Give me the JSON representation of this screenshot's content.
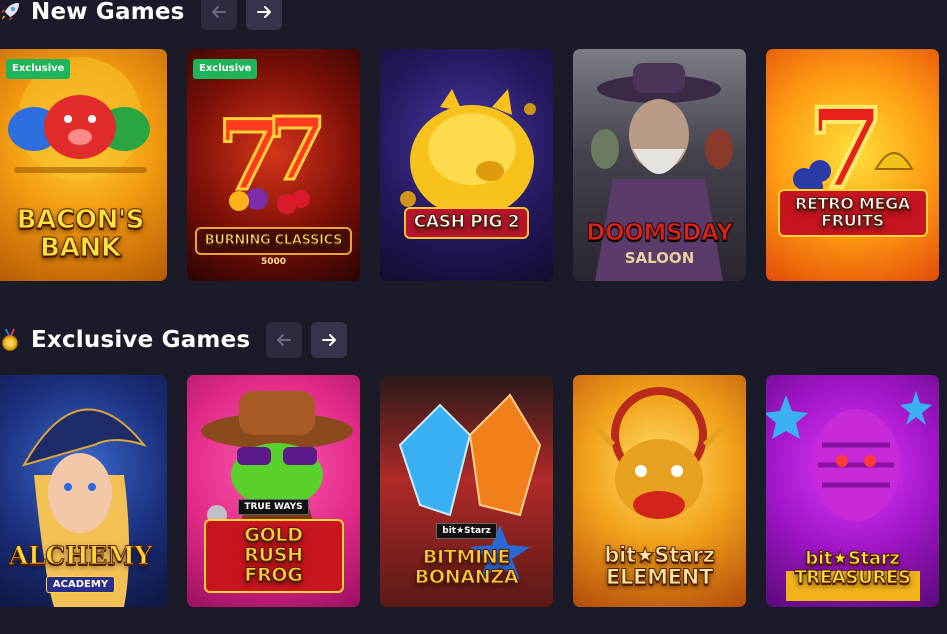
{
  "sections": [
    {
      "title": "New Games",
      "icon": "rocket-icon",
      "games": [
        {
          "title": "BACON'S BANK",
          "subtitle": "",
          "top_tag": "",
          "badge": "Exclusive"
        },
        {
          "title": "BURNING CLASSICS",
          "subtitle": "5000",
          "top_tag": "",
          "badge": "Exclusive"
        },
        {
          "title": "CASH PIG 2",
          "subtitle": "",
          "top_tag": "",
          "badge": ""
        },
        {
          "title": "DOOMSDAY",
          "subtitle": "SALOON",
          "top_tag": "",
          "badge": ""
        },
        {
          "title": "RETRO MEGA FRUITS",
          "subtitle": "",
          "top_tag": "",
          "badge": ""
        }
      ]
    },
    {
      "title": "Exclusive Games",
      "icon": "medal-icon",
      "games": [
        {
          "title": "ALCHEMY",
          "subtitle": "ACADEMY",
          "top_tag": "",
          "badge": ""
        },
        {
          "title": "GOLD RUSH FROG",
          "subtitle": "",
          "top_tag": "TRUE WAYS",
          "badge": ""
        },
        {
          "title": "BITMINE BONANZA",
          "subtitle": "",
          "top_tag": "bit★Starz",
          "badge": ""
        },
        {
          "title": "bit★Starz ELEMENT",
          "subtitle": "",
          "top_tag": "",
          "badge": ""
        },
        {
          "title": "bit★Starz TREASURES",
          "subtitle": "",
          "top_tag": "",
          "badge": ""
        }
      ]
    }
  ],
  "colors": {
    "background": "#1b1a29",
    "arrow_button": "#35344b",
    "badge": "#1eb55a"
  }
}
